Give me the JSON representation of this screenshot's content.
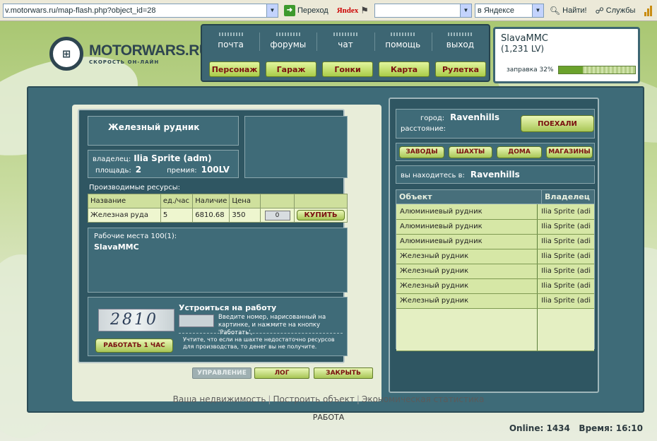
{
  "browser": {
    "address": "v.motorwars.ru/map-flash.php?object_id=28",
    "go_label": "Переход",
    "yandex_logo": "Яndex",
    "search_value": "",
    "search_scope": "в Яндексе",
    "find_label": "Найти!",
    "services_label": "Службы"
  },
  "logo": {
    "title": "MOTORWARS.RU",
    "subtitle": "СКОРОСТЬ ОН-ЛАЙН"
  },
  "nav": {
    "top_links": [
      "почта",
      "форумы",
      "чат",
      "помощь",
      "выход"
    ],
    "game_buttons": [
      "Персонаж",
      "Гараж",
      "Гонки",
      "Карта",
      "Рулетка"
    ]
  },
  "user": {
    "name": "SlavaMMC",
    "level": "(1,231 LV)",
    "fuel_label": "заправка 32%",
    "fuel_percent": 32
  },
  "object": {
    "title": "Железный рудник",
    "owner_label": "владелец:",
    "owner": "Ilia Sprite (adm)",
    "area_label": "площадь:",
    "area": "2",
    "bonus_label": "премия:",
    "bonus": "100LV",
    "resources_title": "Производимые ресурсы:",
    "resources_headers": [
      "Название",
      "ед./час",
      "Наличие",
      "Цена",
      ""
    ],
    "resources_rows": [
      {
        "name": "Железная руда",
        "rate": "5",
        "stock": "6810.68",
        "price": "350",
        "qty": "0"
      }
    ],
    "buy_label": "КУПИТЬ",
    "workplaces_label": "Рабочие места 100(1):",
    "workers": "SlavaMMC",
    "job_title": "Устроиться на работу",
    "captcha_text": "2810",
    "job_instructions": "Введите номер, нарисованный на картинке, и нажмите на кнопку 'Работать',",
    "work_button": "РАБОТАТЬ 1 ЧАС",
    "job_note": "Учтите, что если на шахте недостаточно ресурсов для производства, то денег вы не получите.",
    "tabs": [
      "УПРАВЛЕНИЕ",
      "ЛОГ",
      "ЗАКРЫТЬ"
    ]
  },
  "city": {
    "city_label": "город:",
    "city_name": "Ravenhills",
    "distance_label": "расстояние:",
    "go_button": "ПОЕХАЛИ",
    "categories": [
      "ЗАВОДЫ",
      "ШАХТЫ",
      "ДОМА",
      "МАГАЗИНЫ"
    ],
    "location_label": "вы находитесь в:",
    "location": "Ravenhills",
    "table_headers": [
      "Объект",
      "Владелец"
    ],
    "objects": [
      {
        "name": "Алюминиевый рудник",
        "owner": "Ilia Sprite (adi"
      },
      {
        "name": "Алюминиевый рудник",
        "owner": "Ilia Sprite (adi"
      },
      {
        "name": "Алюминиевый рудник",
        "owner": "Ilia Sprite (adi"
      },
      {
        "name": "Железный рудник",
        "owner": "Ilia Sprite (adi"
      },
      {
        "name": "Железный рудник",
        "owner": "Ilia Sprite (adi"
      },
      {
        "name": "Железный рудник",
        "owner": "Ilia Sprite (adi"
      },
      {
        "name": "Железный рудник",
        "owner": "Ilia Sprite (adi"
      }
    ]
  },
  "footer": {
    "links": [
      "Ваша недвижимость",
      "Построить объект",
      "Экономическая статистика"
    ],
    "status": "РАБОТА",
    "online_label": "Online:",
    "online_count": "1434",
    "time_label": "Время:",
    "time": "16:10"
  }
}
